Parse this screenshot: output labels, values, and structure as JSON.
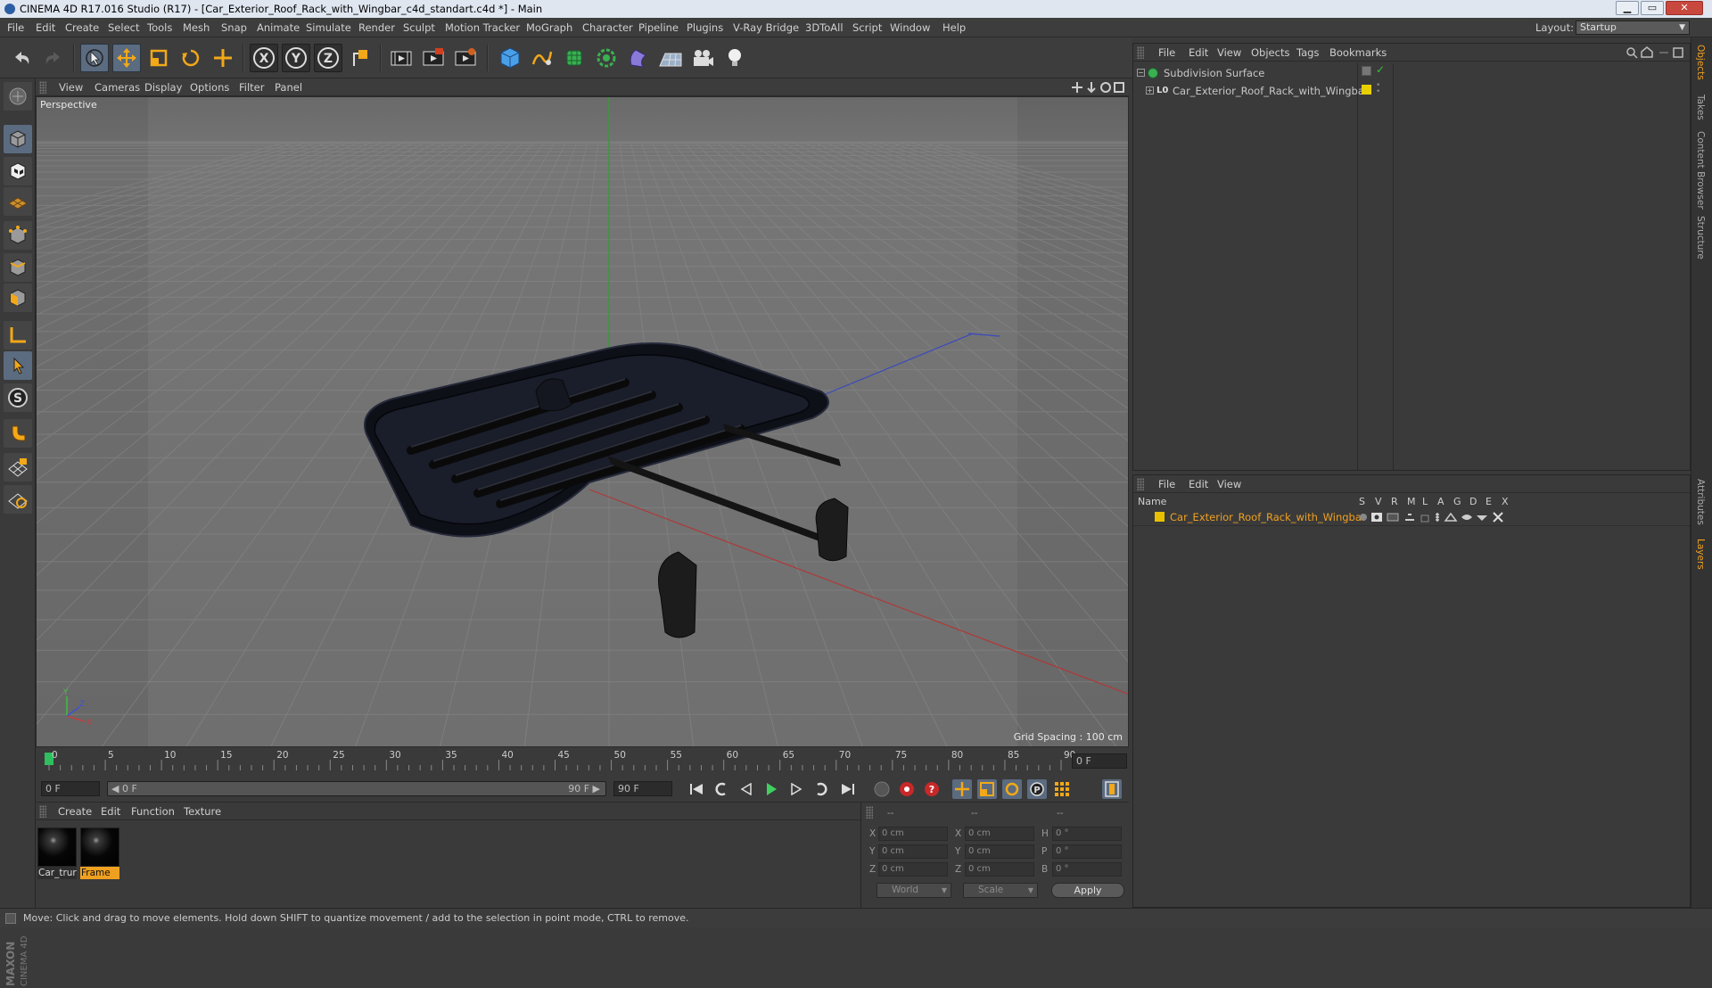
{
  "window": {
    "title": "CINEMA 4D R17.016 Studio (R17) - [Car_Exterior_Roof_Rack_with_Wingbar_c4d_standart.c4d *] - Main",
    "min": "▁",
    "max": "▭",
    "close": "✕"
  },
  "menubar": {
    "items": [
      "File",
      "Edit",
      "Create",
      "Select",
      "Tools",
      "Mesh",
      "Snap",
      "Animate",
      "Simulate",
      "Render",
      "Sculpt",
      "Motion Tracker",
      "MoGraph",
      "Character",
      "Pipeline",
      "Plugins",
      "V-Ray Bridge",
      "3DToAll",
      "Script",
      "Window",
      "Help"
    ],
    "layout_label": "Layout:",
    "layout_value": "Startup"
  },
  "toolbar": {
    "axis_x": "X",
    "axis_y": "Y",
    "axis_z": "Z",
    "icons": [
      "undo-icon",
      "redo-icon",
      "select-arrow-icon",
      "move-icon",
      "scale-icon",
      "rotate-icon",
      "last-tool-icon",
      "lock-x-icon",
      "lock-y-icon",
      "lock-z-icon",
      "world-coordinates-icon",
      "render-view-icon",
      "render-picture-viewer-icon",
      "render-settings-icon",
      "cube-primitive-icon",
      "pen-spline-icon",
      "subdivision-surface-icon",
      "cloner-icon",
      "deformer-icon",
      "floor-icon",
      "camera-icon",
      "light-icon"
    ]
  },
  "viewport": {
    "menu": [
      "View",
      "Cameras",
      "Display",
      "Options",
      "Filter",
      "Panel"
    ],
    "camera_label": "Perspective",
    "grid_spacing": "Grid Spacing : 100 cm",
    "colors": {
      "bg": "#737373",
      "grid": "#888888",
      "x_axis": "#b03030",
      "y_axis": "#30b030",
      "z_axis": "#3040b0"
    }
  },
  "timeline": {
    "ticks": [
      "0",
      "5",
      "10",
      "15",
      "20",
      "25",
      "30",
      "35",
      "40",
      "45",
      "50",
      "55",
      "60",
      "65",
      "70",
      "75",
      "80",
      "85",
      "90"
    ],
    "current_frame_field": "0 F",
    "start_field": "0 F",
    "range_start": "◀ 0 F",
    "range_end": "90 F ▶",
    "end_field": "90 F"
  },
  "materials": {
    "menu": [
      "Create",
      "Edit",
      "Function",
      "Texture"
    ],
    "items": [
      {
        "label": "Car_trur",
        "active": false
      },
      {
        "label": "Frame",
        "active": true
      }
    ]
  },
  "coordinates": {
    "header": [
      "--",
      "--",
      "--"
    ],
    "rows": [
      {
        "a_label": "X",
        "a_value": "0 cm",
        "b_label": "X",
        "b_value": "0 cm",
        "c_label": "H",
        "c_value": "0 °"
      },
      {
        "a_label": "Y",
        "a_value": "0 cm",
        "b_label": "Y",
        "b_value": "0 cm",
        "c_label": "P",
        "c_value": "0 °"
      },
      {
        "a_label": "Z",
        "a_value": "0 cm",
        "b_label": "Z",
        "b_value": "0 cm",
        "c_label": "B",
        "c_value": "0 °"
      }
    ],
    "mode_world": "World",
    "mode_scale": "Scale",
    "apply": "Apply"
  },
  "objects_panel": {
    "menu": [
      "File",
      "Edit",
      "View",
      "Objects",
      "Tags",
      "Bookmarks"
    ],
    "items": [
      {
        "name": "Subdivision Surface",
        "color": "#d8d8d8"
      },
      {
        "name": "Car_Exterior_Roof_Rack_with_Wingbar",
        "color": "#d8d8d8",
        "tag_color": "#e8d000"
      }
    ]
  },
  "layers_panel": {
    "menu": [
      "File",
      "Edit",
      "View"
    ],
    "col_name": "Name",
    "columns": [
      "S",
      "V",
      "R",
      "M",
      "L",
      "A",
      "G",
      "D",
      "E",
      "X"
    ],
    "items": [
      {
        "name": "Car_Exterior_Roof_Rack_with_Wingbar",
        "color": "#e8c000",
        "text_color": "#f0a020"
      }
    ]
  },
  "right_tabs": [
    "Objects",
    "Takes",
    "Content Browser",
    "Structure",
    "Attributes",
    "Layers"
  ],
  "brand": {
    "top": "MAXON",
    "bottom": "CINEMA 4D"
  },
  "statusbar": {
    "text": "Move: Click and drag to move elements. Hold down SHIFT to quantize movement / add to the selection in point mode, CTRL to remove."
  }
}
